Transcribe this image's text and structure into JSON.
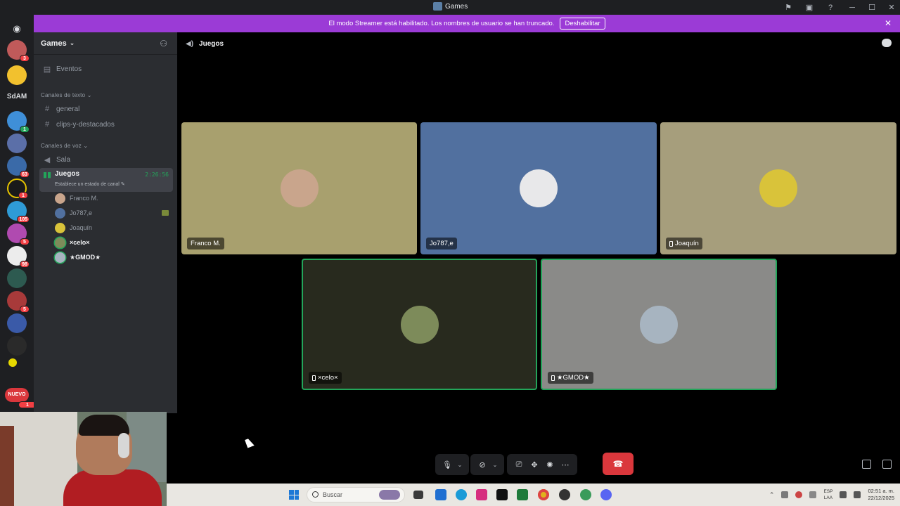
{
  "window": {
    "title": "Games"
  },
  "banner": {
    "text": "El modo Streamer está habilitado. Los nombres de usuario se han truncado.",
    "button": "Deshabilitar"
  },
  "servers": {
    "label_sdam": "SdAM",
    "badges": [
      "3",
      "1",
      "63",
      "1",
      "105",
      "5",
      "98",
      "5",
      "1"
    ],
    "new_label": "NUEVO"
  },
  "sidebar": {
    "server_name": "Games",
    "events": "Eventos",
    "text_category": "Canales de texto",
    "text_channels": [
      "general",
      "clips-y-destacados"
    ],
    "voice_category": "Canales de voz",
    "voice_channels": [
      "Sala",
      "Juegos"
    ],
    "active_status": "Establece un estado de canal",
    "active_time": "2:26:56",
    "voice_users": [
      "Franco M.",
      "Jo787,e",
      "Joaquín",
      "×celo×",
      "★GMOD★"
    ]
  },
  "channel_header": {
    "name": "Juegos"
  },
  "tiles": [
    {
      "name": "Franco M.",
      "mobile": false,
      "speaking": false,
      "bg": "#a8a06e",
      "avatar": "#c9a58c"
    },
    {
      "name": "Jo787,e",
      "mobile": false,
      "speaking": false,
      "bg": "#51709f",
      "avatar": "#e8e8ea"
    },
    {
      "name": "Joaquín",
      "mobile": true,
      "speaking": false,
      "bg": "#a69e7c",
      "avatar": "#d9c33a"
    },
    {
      "name": "×celo×",
      "mobile": true,
      "speaking": true,
      "bg": "#282a1e",
      "avatar": "#7d8b5a"
    },
    {
      "name": "★GMOD★",
      "mobile": true,
      "speaking": true,
      "bg": "#8a8a88",
      "avatar": "#a7b4c0"
    }
  ],
  "taskbar": {
    "search_placeholder": "Buscar",
    "lang_top": "ESP",
    "lang_bottom": "LAA",
    "time": "02:51 a. m.",
    "date": "22/12/2025"
  },
  "colors": {
    "accent_banner": "#9b3bd6",
    "speaking": "#23a55a",
    "leave": "#da373c"
  }
}
